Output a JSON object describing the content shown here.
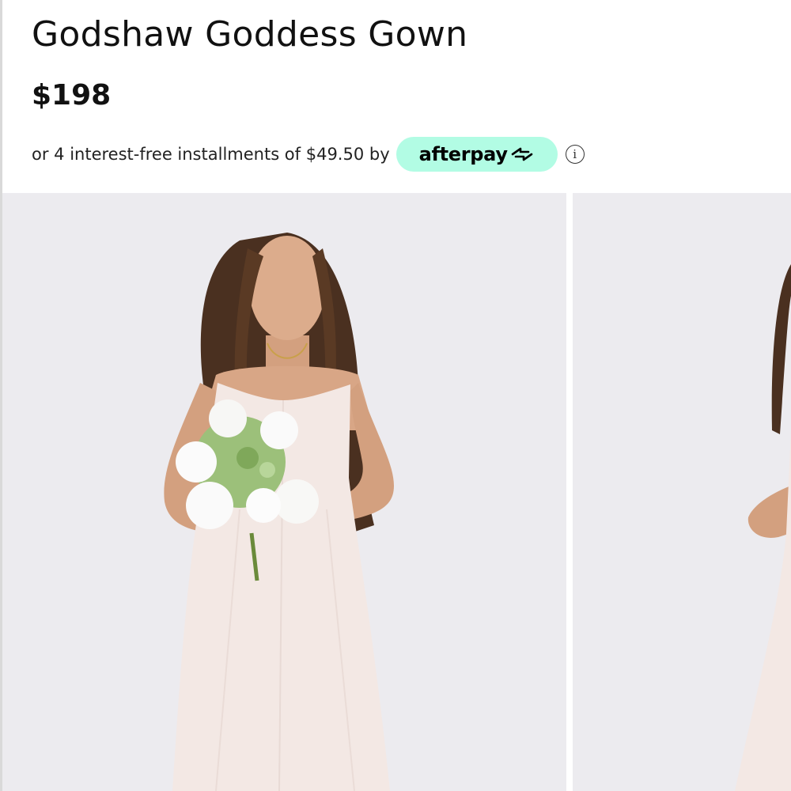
{
  "product": {
    "title": "Godshaw Goddess Gown",
    "price": "$198"
  },
  "installments": {
    "text": "or 4 interest-free installments of $49.50 by",
    "provider": "afterpay",
    "provider_icon": "afterpay-arrows-icon",
    "info_glyph": "i",
    "info_icon": "info-icon"
  },
  "gallery": {
    "images": [
      {
        "alt": "product-photo-front"
      },
      {
        "alt": "product-photo-side"
      }
    ]
  },
  "colors": {
    "afterpay_badge": "#b2fce4",
    "photo_background": "#ecebef",
    "dress": "#f3e8e4",
    "skin": "#d9a988",
    "hair": "#4a3020"
  }
}
